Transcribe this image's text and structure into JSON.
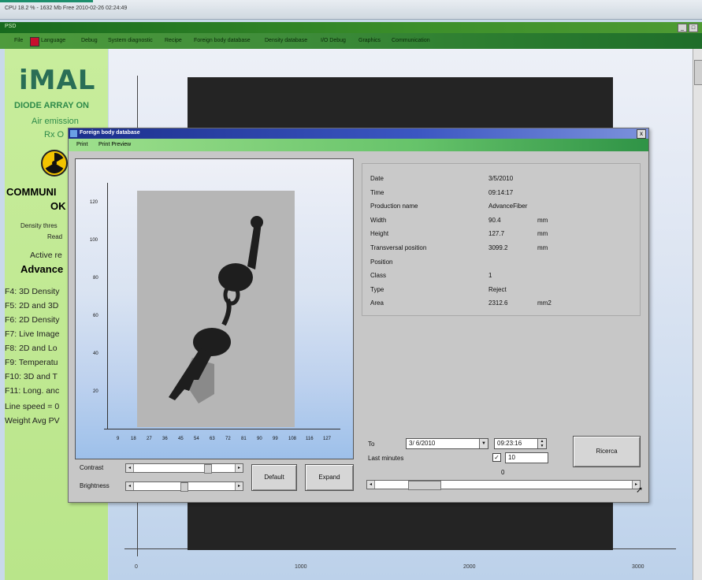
{
  "status_bar": {
    "text": "CPU 18.2 % - 1632 Mb Free  2010-02-26 02:24:49"
  },
  "window": {
    "title": "PSD",
    "buttons": [
      "_",
      "□"
    ]
  },
  "menu": [
    "File",
    "Language",
    "Debug",
    "System diagnostic",
    "Recipe",
    "Foreign body database",
    "Density database",
    "I/O Debug",
    "Graphics",
    "Communication"
  ],
  "sidebar": {
    "logo": "iMAL",
    "lines": [
      "DIODE ARRAY ON",
      "Air emission",
      "Rx O",
      "COMMUNI",
      "OK",
      "Density thres",
      "Read",
      "Active re",
      "Advance",
      "F4: 3D Density",
      "F5: 2D and 3D",
      "F6: 2D Density",
      "F7: Live Image",
      "F8: 2D and Lo",
      "F9: Temperatu",
      "F10: 3D and T",
      "F11: Long. anc",
      "Line speed = 0",
      "Weight Avg PV"
    ]
  },
  "background_plot": {
    "x_ticks": [
      "0",
      "1000",
      "2000",
      "3000"
    ]
  },
  "dialog": {
    "title": "Foreign body database",
    "menu": [
      "Print",
      "Print Preview"
    ],
    "close": "x",
    "image": {
      "y_ticks": [
        "120",
        "100",
        "80",
        "60",
        "40",
        "20"
      ],
      "x_ticks": [
        "9",
        "18",
        "27",
        "36",
        "45",
        "54",
        "63",
        "72",
        "81",
        "90",
        "99",
        "108",
        "116",
        "127"
      ]
    },
    "info": [
      {
        "label": "Date",
        "value": "3/5/2010",
        "unit": ""
      },
      {
        "label": "Time",
        "value": "09:14:17",
        "unit": ""
      },
      {
        "label": "Production name",
        "value": "AdvanceFiber",
        "unit": ""
      },
      {
        "label": "Width",
        "value": "90.4",
        "unit": "mm"
      },
      {
        "label": "Height",
        "value": "127.7",
        "unit": "mm"
      },
      {
        "label": "Transversal position",
        "value": "3099.2",
        "unit": "mm"
      },
      {
        "label": "Position",
        "value": "",
        "unit": ""
      },
      {
        "label": "Class",
        "value": "1",
        "unit": ""
      },
      {
        "label": "Type",
        "value": "Reject",
        "unit": ""
      },
      {
        "label": "Area",
        "value": "2312.6",
        "unit": "mm2"
      }
    ],
    "controls": {
      "contrast_label": "Contrast",
      "brightness_label": "Brightness",
      "contrast_level": 0.75,
      "brightness_level": 0.5,
      "default_button": "Default",
      "expand_button": "Expand",
      "to_label": "To",
      "date_value": "3/ 6/2010",
      "time_value": "09:23:16",
      "last_minutes_label": "Last minutes",
      "last_minutes_checked": true,
      "last_minutes_value": "10",
      "record_value": "0",
      "search_button": "Ricerca"
    }
  }
}
